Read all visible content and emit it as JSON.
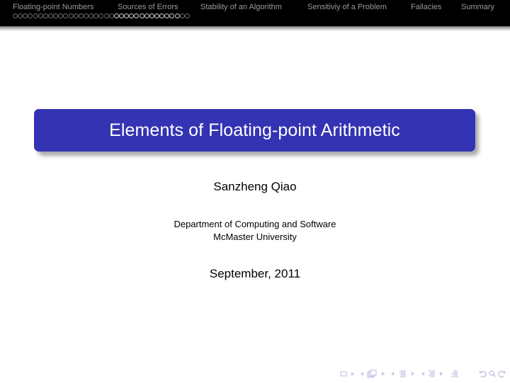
{
  "header": {
    "sections": [
      {
        "label": "Floating-point Numbers",
        "active": false
      },
      {
        "label": "Sources of Errors",
        "active": false
      },
      {
        "label": "Stability of an Algorithm",
        "active": false
      },
      {
        "label": "Sensitiviy of a Problem",
        "active": false
      },
      {
        "label": "Fallacies",
        "active": false
      },
      {
        "label": "Summary",
        "active": false
      }
    ],
    "frame_dots": {
      "before_current": 20,
      "current_highlighted": 13,
      "after_current": 2
    }
  },
  "slide": {
    "title": "Elements of Floating-point Arithmetic",
    "author": "Sanzheng Qiao",
    "institute_line1": "Department of Computing and Software",
    "institute_line2": "McMaster University",
    "date": "September, 2011"
  },
  "navigation_symbols": [
    {
      "name": "frame-icon"
    },
    {
      "name": "frame-forward-icon"
    },
    {
      "name": "subsection-back-icon"
    },
    {
      "name": "subsection-icon"
    },
    {
      "name": "subsection-forward-icon"
    },
    {
      "name": "section-back-icon"
    },
    {
      "name": "section-icon"
    },
    {
      "name": "section-forward-icon"
    },
    {
      "name": "document-back-icon"
    },
    {
      "name": "document-icon"
    },
    {
      "name": "document-forward-icon"
    },
    {
      "name": "appendix-icon"
    },
    {
      "name": "undo-icon"
    },
    {
      "name": "search-icon"
    },
    {
      "name": "redo-icon"
    }
  ],
  "colors": {
    "title_box": "#3333b3",
    "header_bg": "#000000",
    "header_text": "#9a9a9a",
    "nav_symbol": "#b8b8e0"
  }
}
